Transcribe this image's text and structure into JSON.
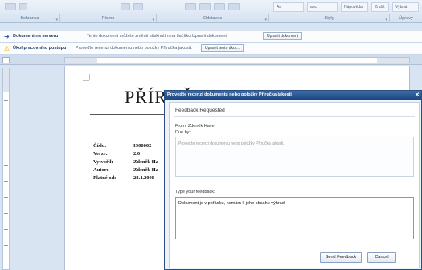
{
  "ribbon": {
    "controls": [
      "Aa",
      "abc",
      "Nápověda",
      "Zrušit"
    ],
    "groups": [
      {
        "label": "Schránka"
      },
      {
        "label": "Písmo"
      },
      {
        "label": "Odstavec"
      },
      {
        "label": "Styly"
      },
      {
        "label": "Úpravy"
      }
    ],
    "right_controls": [
      "Vybrat"
    ]
  },
  "messagebar_server": {
    "title": "Dokument na serveru",
    "text": "Tento dokument můžete změnit stisknutím na tlačítko Upravit dokument.",
    "button": "Upravit dokument"
  },
  "messagebar_workflow": {
    "title": "Úkol pracovního postupu",
    "text": "Proveďte recenzi dokumentu nebo položky Příručka jakosti.",
    "button": "Upravit tento úkol..."
  },
  "document": {
    "title": "PŘÍRUČKA JAKOSTI",
    "fields": [
      {
        "label": "Číslo:",
        "value": "IS00002"
      },
      {
        "label": "Verze:",
        "value": "2.0"
      },
      {
        "label": "Vytvořil:",
        "value": "Zdeněk Ha"
      },
      {
        "label": "Autor:",
        "value": "Zdeněk Ha"
      },
      {
        "label": "Platné od:",
        "value": "28.4.2008"
      }
    ]
  },
  "dialog": {
    "title": "Proveďte recenzi dokumentu nebo položky Příručka jakosti",
    "heading": "Feedback Requested",
    "from": "From: Zdeněk Havel",
    "due": "Due by:",
    "request_text": "Proveďte recenzi dokumentu nebo položky Příručka jakosti.",
    "type_label": "Type your feedback:",
    "feedback_value": "Dokument je v pořádku, nemám k jeho obsahu výhrad.",
    "send_button": "Send Feedback",
    "cancel_button": "Cancel"
  },
  "colors": {
    "dialog_titlebar": "#1e4781",
    "ribbon_bg": "#d6e2f1",
    "warning_icon": "#e8b400",
    "info_icon": "#2a5aa0"
  }
}
